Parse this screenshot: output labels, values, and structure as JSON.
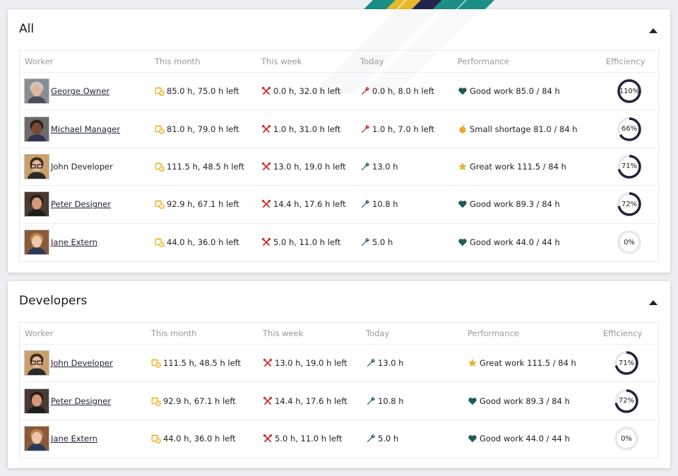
{
  "colors": {
    "month_icon": "#f2b01e",
    "week_icon": "#d0312d",
    "today_bad": "#c62a2a",
    "today_ok": "#2a5f6d",
    "heart": "#1f5a5a",
    "star": "#e2b53a",
    "shortage": "#f0a52a",
    "ring_fill": "#22243a",
    "ring_track": "#e8e8ec"
  },
  "columns": {
    "worker": "Worker",
    "month": "This month",
    "week": "This week",
    "today": "Today",
    "performance": "Performance",
    "efficiency": "Efficiency"
  },
  "sections": [
    {
      "title": "All",
      "rows": [
        {
          "name": "George Owner",
          "link": true,
          "avatar": "avatar-george",
          "month": "85.0 h, 75.0 h left",
          "week": "0.0 h, 32.0 h left",
          "today": "0.0 h, 8.0 h left",
          "today_icon": "wrench-red-icon",
          "perf_icon": "heart-icon",
          "performance": "Good work 85.0 / 84 h",
          "efficiency": "110%",
          "efficiency_value": 110
        },
        {
          "name": "Michael Manager",
          "link": true,
          "avatar": "avatar-michael",
          "month": "81.0 h, 79.0 h left",
          "week": "1.0 h, 31.0 h left",
          "today": "1.0 h, 7.0 h left",
          "today_icon": "wrench-red-icon",
          "perf_icon": "shortage-icon",
          "performance": "Small shortage 81.0 / 84 h",
          "efficiency": "66%",
          "efficiency_value": 66
        },
        {
          "name": "John Developer",
          "link": false,
          "avatar": "avatar-john",
          "month": "111.5 h, 48.5 h left",
          "week": "13.0 h, 19.0 h left",
          "today": "13.0 h",
          "today_icon": "wrench-icon",
          "perf_icon": "star-icon",
          "performance": "Great work 111.5 / 84 h",
          "efficiency": "71%",
          "efficiency_value": 71
        },
        {
          "name": "Peter Designer",
          "link": true,
          "avatar": "avatar-peter",
          "month": "92.9 h, 67.1 h left",
          "week": "14.4 h, 17.6 h left",
          "today": "10.8 h",
          "today_icon": "wrench-icon",
          "perf_icon": "heart-icon",
          "performance": "Good work 89.3 / 84 h",
          "efficiency": "72%",
          "efficiency_value": 72
        },
        {
          "name": "Jane Extern",
          "link": true,
          "avatar": "avatar-jane",
          "month": "44.0 h, 36.0 h left",
          "week": "5.0 h, 11.0 h left",
          "today": "5.0 h",
          "today_icon": "wrench-icon",
          "perf_icon": "heart-icon",
          "performance": "Good work 44.0 / 44 h",
          "efficiency": "0%",
          "efficiency_value": 0
        }
      ]
    },
    {
      "title": "Developers",
      "rows": [
        {
          "name": "John Developer",
          "link": true,
          "avatar": "avatar-john",
          "month": "111.5 h, 48.5 h left",
          "week": "13.0 h, 19.0 h left",
          "today": "13.0 h",
          "today_icon": "wrench-icon",
          "perf_icon": "star-icon",
          "performance": "Great work 111.5 / 84 h",
          "efficiency": "71%",
          "efficiency_value": 71
        },
        {
          "name": "Peter Designer",
          "link": true,
          "avatar": "avatar-peter",
          "month": "92.9 h, 67.1 h left",
          "week": "14.4 h, 17.6 h left",
          "today": "10.8 h",
          "today_icon": "wrench-icon",
          "perf_icon": "heart-icon",
          "performance": "Good work 89.3 / 84 h",
          "efficiency": "72%",
          "efficiency_value": 72
        },
        {
          "name": "Jane Extern",
          "link": true,
          "avatar": "avatar-jane",
          "month": "44.0 h, 36.0 h left",
          "week": "5.0 h, 11.0 h left",
          "today": "5.0 h",
          "today_icon": "wrench-icon",
          "perf_icon": "heart-icon",
          "performance": "Good work 44.0 / 44 h",
          "efficiency": "0%",
          "efficiency_value": 0
        }
      ]
    }
  ]
}
